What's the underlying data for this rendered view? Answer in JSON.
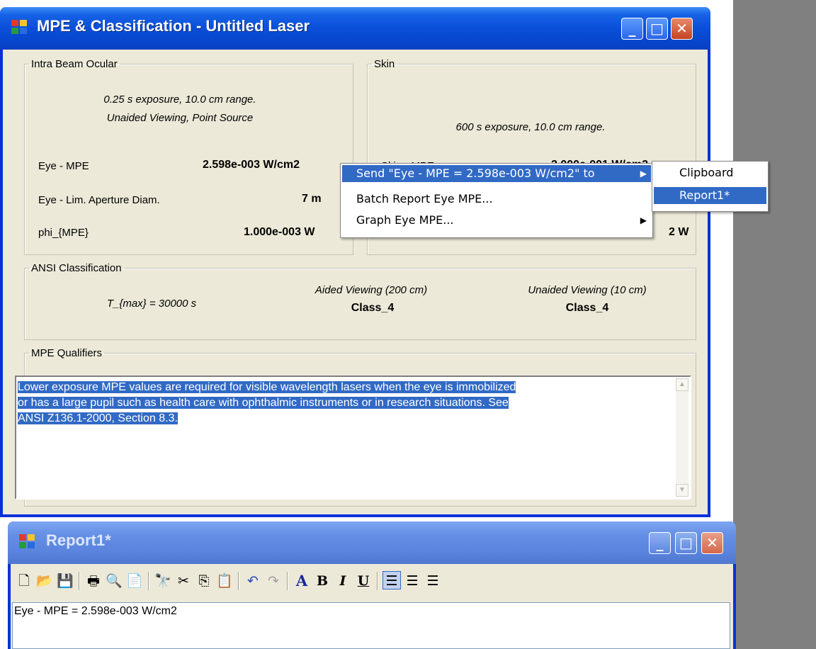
{
  "main_window": {
    "title": "MPE & Classification - Untitled Laser",
    "intra_beam": {
      "legend": "Intra Beam Ocular",
      "conditions_line1": "0.25 s exposure, 10.0 cm range.",
      "conditions_line2": "Unaided Viewing, Point Source",
      "rows": [
        {
          "label": "Eye - MPE",
          "value": "2.598e-003 W/cm2"
        },
        {
          "label": "Eye - Lim. Aperture Diam.",
          "value": "7 m"
        },
        {
          "label": "phi_{MPE}",
          "value": "1.000e-003 W"
        }
      ]
    },
    "skin": {
      "legend": "Skin",
      "conditions": "600 s exposure, 10.0 cm range.",
      "rows": [
        {
          "label": "Skin - MPE",
          "value": "2.000e-001 W/cm2"
        },
        {
          "label": "",
          "value": "2 W"
        }
      ]
    },
    "ansi": {
      "legend": "ANSI Classification",
      "tmax": "T_{max} = 30000 s",
      "aided_label": "Aided Viewing (200 cm)",
      "aided_class": "Class_4",
      "unaided_label": "Unaided Viewing (10 cm)",
      "unaided_class": "Class_4"
    },
    "qualifiers": {
      "legend": "MPE Qualifiers",
      "line1": "Lower exposure MPE values are required for visible wavelength lasers when the eye is immobilized",
      "line2": "or has a large pupil such as health care with ophthalmic instruments or in research situations.  See",
      "line3": "ANSI Z136.1-2000, Section 8.3."
    }
  },
  "context_menu": {
    "items": [
      {
        "label": "Send \"Eye - MPE = 2.598e-003 W/cm2\" to",
        "highlighted": true,
        "has_submenu": true
      },
      {
        "label": "Batch Report Eye MPE...",
        "highlighted": false,
        "has_submenu": false
      },
      {
        "label": "Graph Eye MPE...",
        "highlighted": false,
        "has_submenu": true
      }
    ],
    "submenu": [
      {
        "label": "Clipboard",
        "highlighted": false
      },
      {
        "label": "Report1*",
        "highlighted": true
      }
    ],
    "arrow_glyph": "▶"
  },
  "report_window": {
    "title": "Report1*",
    "editor_text": "Eye - MPE = 2.598e-003 W/cm2",
    "toolbar": {
      "bold": "B",
      "italic": "I",
      "underline": "U",
      "font": "A"
    }
  },
  "window_buttons": {
    "minimize": "_",
    "maximize": "□",
    "close": "✕"
  },
  "colors": {
    "title_active": "#0a4fd8",
    "selection": "#316ac5",
    "dialog_bg": "#ece9d8"
  }
}
